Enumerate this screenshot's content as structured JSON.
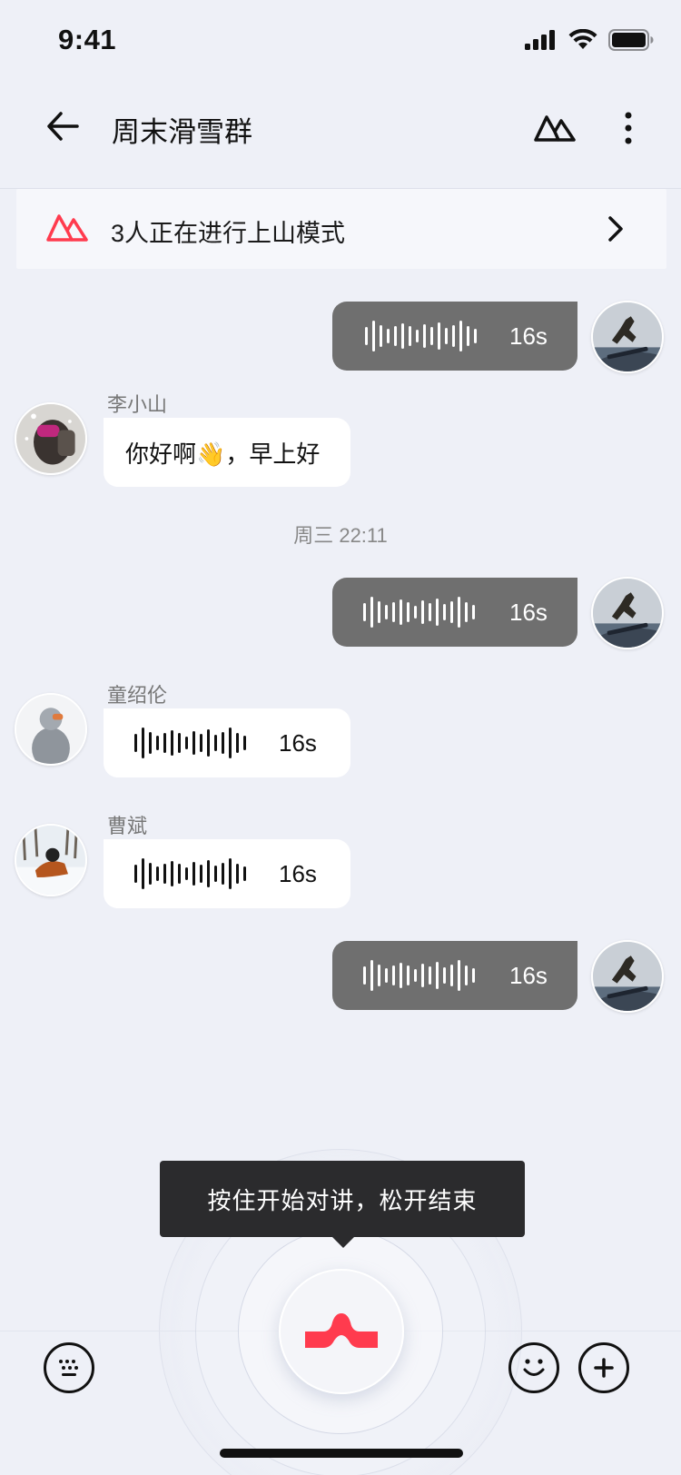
{
  "status_bar": {
    "time": "9:41"
  },
  "header": {
    "title": "周末滑雪群"
  },
  "banner": {
    "text": "3人正在进行上山模式",
    "accent_color": "#ff3b4e"
  },
  "messages": {
    "m1": {
      "type": "voice",
      "direction": "out",
      "duration": "16s"
    },
    "m2": {
      "type": "text",
      "direction": "in",
      "sender": "李小山",
      "text": "你好啊👋，早上好"
    },
    "timestamp": "周三 22:11",
    "m3": {
      "type": "voice",
      "direction": "out",
      "duration": "16s"
    },
    "m4": {
      "type": "voice",
      "direction": "in",
      "sender": "童绍伦",
      "duration": "16s"
    },
    "m5": {
      "type": "voice",
      "direction": "in",
      "sender": "曹斌",
      "duration": "16s"
    },
    "m6": {
      "type": "voice",
      "direction": "out",
      "duration": "16s"
    }
  },
  "talk": {
    "tooltip": "按住开始对讲，松开结束",
    "accent_color": "#ff3b4e"
  },
  "icons": {
    "back": "arrow-left-icon",
    "mountain": "mountain-icon",
    "more": "more-vertical-icon",
    "chevron": "chevron-right-icon",
    "keyboard": "keyboard-icon",
    "emoji": "smile-icon",
    "plus": "plus-icon"
  }
}
